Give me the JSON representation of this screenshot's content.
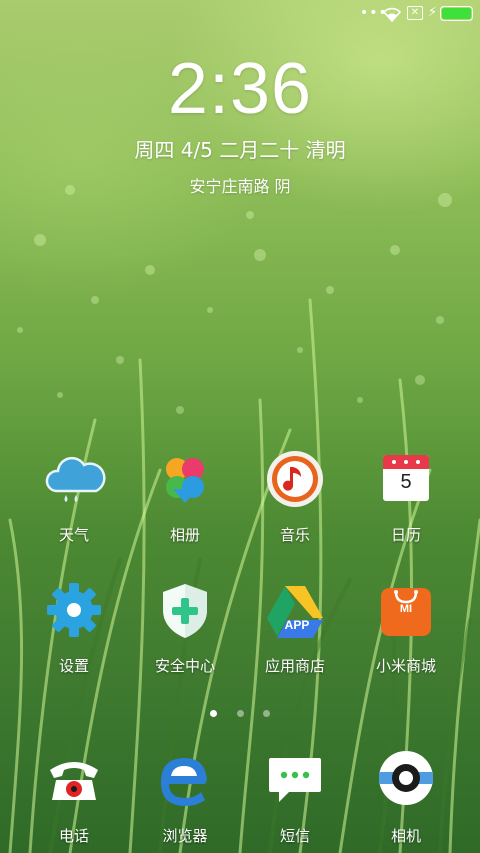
{
  "status_bar": {
    "more_dots": "•••",
    "no_sim": "✕",
    "charging": "⚡",
    "battery_level": 1.0
  },
  "clock": "2:36",
  "date_line": "周四 4/5 二月二十 清明",
  "weather_line": "安宁庄南路  阴",
  "apps": [
    {
      "label": "天气",
      "icon": "weather-icon"
    },
    {
      "label": "相册",
      "icon": "gallery-icon"
    },
    {
      "label": "音乐",
      "icon": "music-icon"
    },
    {
      "label": "日历",
      "icon": "calendar-icon",
      "calendar_day": "5"
    },
    {
      "label": "设置",
      "icon": "settings-gear-icon"
    },
    {
      "label": "安全中心",
      "icon": "security-shield-icon"
    },
    {
      "label": "应用商店",
      "icon": "app-store-icon",
      "badge": "APP"
    },
    {
      "label": "小米商城",
      "icon": "mi-store-bag-icon",
      "badge": "MI"
    }
  ],
  "page_indicator": {
    "count": 3,
    "active": 0
  },
  "dock": [
    {
      "label": "电话",
      "icon": "phone-icon"
    },
    {
      "label": "浏览器",
      "icon": "browser-icon"
    },
    {
      "label": "短信",
      "icon": "messages-icon"
    },
    {
      "label": "相机",
      "icon": "camera-icon"
    }
  ],
  "colors": {
    "battery": "#3ee03a",
    "calendar_red": "#e8394a",
    "music_orange": "#e8631c",
    "settings_blue": "#2aa3e0",
    "shield_green": "#2ec48a",
    "store_orange": "#f06a1e",
    "browser_blue": "#2b7fd6"
  }
}
